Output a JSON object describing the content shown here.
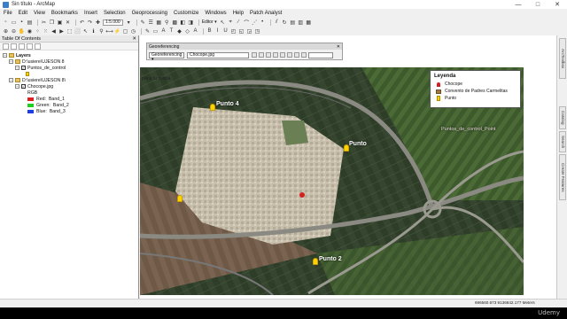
{
  "window": {
    "title": "Sin título - ArcMap",
    "controls": [
      "—",
      "□",
      "✕"
    ]
  },
  "menubar": [
    "File",
    "Edit",
    "View",
    "Bookmarks",
    "Insert",
    "Selection",
    "Geoprocessing",
    "Customize",
    "Windows",
    "Help",
    "Patch Analyst"
  ],
  "toolbar": {
    "scale": "1:5.000",
    "editor_label": "Editor ▾"
  },
  "toc": {
    "title": "Table Of Contents",
    "close": "✕",
    "items": [
      {
        "label": "Layers"
      },
      {
        "label": "D:\\usiere\\UJESON 8"
      },
      {
        "label": "Puntos_de_control"
      },
      {
        "label": "D:\\usiere\\UJESON 8\\"
      },
      {
        "label": "Chocope.jpg"
      },
      {
        "label": "RGB"
      },
      {
        "label": "Red:",
        "band": "Band_1",
        "color": "#e11e1e"
      },
      {
        "label": "Green:",
        "band": "Band_2",
        "color": "#1ed01e"
      },
      {
        "label": "Blue:",
        "band": "Band_3",
        "color": "#1e3ce1"
      }
    ]
  },
  "georeferencing": {
    "title": "Georeferencing",
    "menu": "Georeferencing ▾",
    "layer": "Chocope.jpg"
  },
  "map": {
    "note": "para tu mapa",
    "points": [
      {
        "label": "Punto 4"
      },
      {
        "label": "Punto"
      },
      {
        "label": "Punto 2"
      },
      {
        "label": "Puntos_de_control_Point"
      }
    ],
    "marker_color": "#ffd200"
  },
  "legend": {
    "title": "Leyenda",
    "items": [
      {
        "label": "Chocope",
        "icon": "red-pin-icon"
      },
      {
        "label": "Convento de Padres Carmelitas",
        "icon": "church-icon"
      },
      {
        "label": "Punto",
        "icon": "yellow-pin-icon"
      }
    ]
  },
  "right_panel": [
    "ArcToolbox",
    "Catalog",
    "Search",
    "Create Features"
  ],
  "status": {
    "coords": "696560.673  9136842.177 Meters"
  },
  "watermark": "Udemy"
}
